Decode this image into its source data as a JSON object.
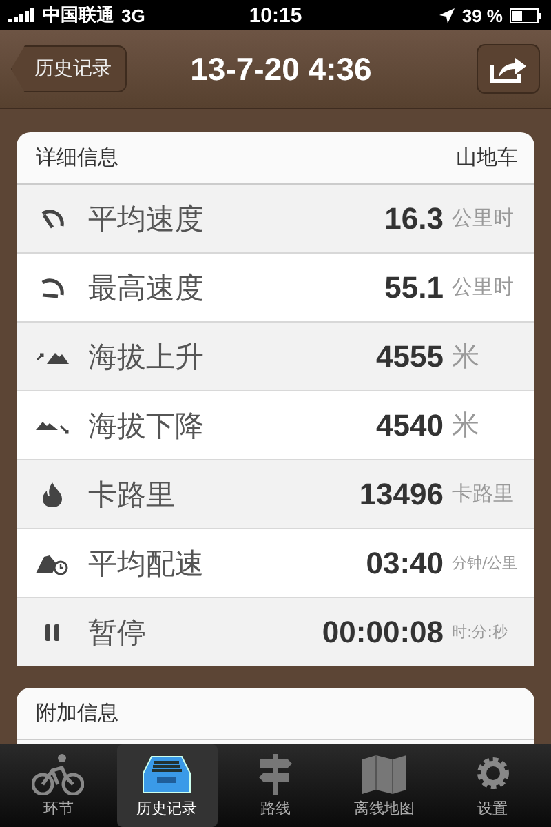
{
  "status_bar": {
    "carrier": "中国联通",
    "network": "3G",
    "time": "10:15",
    "battery": "39 %"
  },
  "nav_bar": {
    "back": "历史记录",
    "title": "13-7-20 4:36"
  },
  "details": {
    "title": "详细信息",
    "bike_type": "山地车",
    "rows": [
      {
        "kind": "avg-speed",
        "label": "平均速度",
        "value": "16.3",
        "unit": "公里时"
      },
      {
        "kind": "max-speed",
        "label": "最高速度",
        "value": "55.1",
        "unit": "公里时"
      },
      {
        "kind": "ascent",
        "label": "海拔上升",
        "value": "4555",
        "unit": "米"
      },
      {
        "kind": "descent",
        "label": "海拔下降",
        "value": "4540",
        "unit": "米"
      },
      {
        "kind": "calories",
        "label": "卡路里",
        "value": "13496",
        "unit": "卡路里"
      },
      {
        "kind": "pace",
        "label": "平均配速",
        "value": "03:40",
        "unit": "分钟/公里"
      },
      {
        "kind": "pause",
        "label": "暂停",
        "value": "00:00:08",
        "unit": "时:分:秒"
      }
    ]
  },
  "extra": {
    "title": "附加信息"
  },
  "tab_bar": [
    {
      "kind": "ride",
      "label": "环节",
      "selected": false
    },
    {
      "kind": "history",
      "label": "历史记录",
      "selected": true
    },
    {
      "kind": "route",
      "label": "路线",
      "selected": false
    },
    {
      "kind": "map",
      "label": "离线地图",
      "selected": false
    },
    {
      "kind": "settings",
      "label": "设置",
      "selected": false
    }
  ]
}
